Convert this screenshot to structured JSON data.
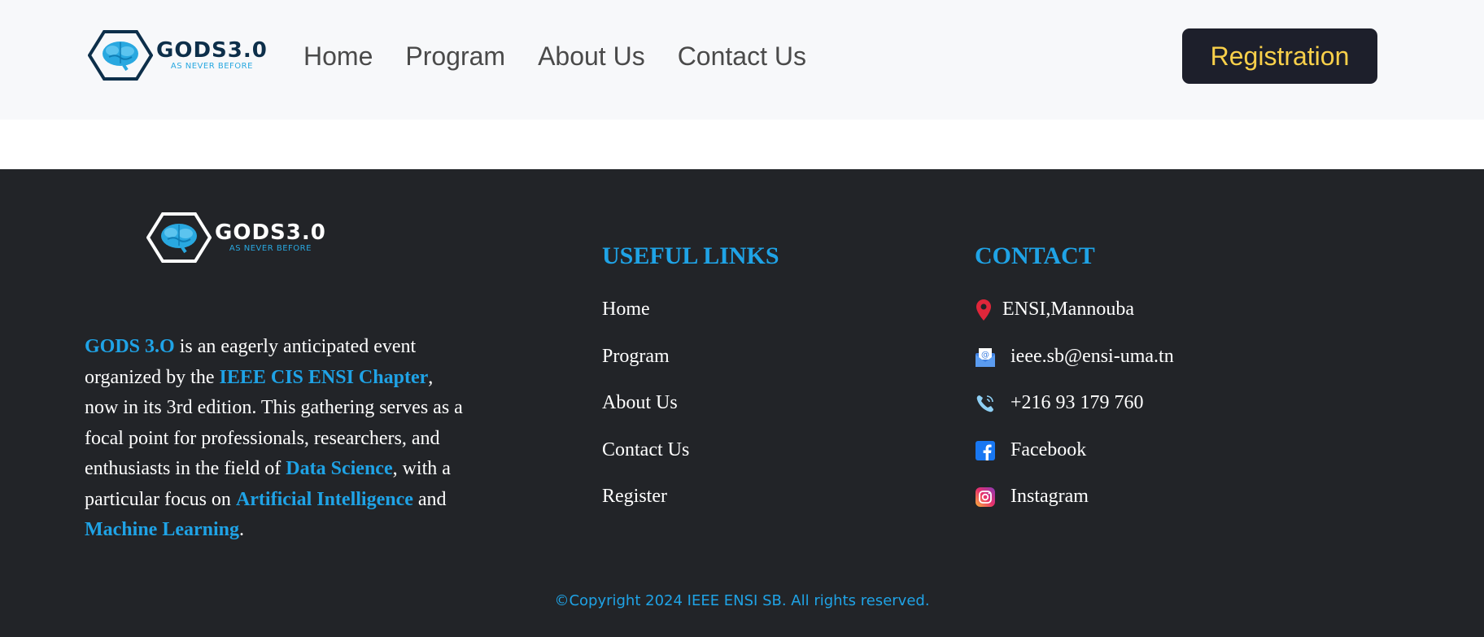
{
  "brand": {
    "name": "GODS3.0",
    "tagline": "AS NEVER BEFORE"
  },
  "nav": {
    "items": [
      "Home",
      "Program",
      "About Us",
      "Contact Us"
    ],
    "cta_label": "Registration"
  },
  "footer": {
    "about": {
      "event_name": "GODS 3.O",
      "text1": " is an eagerly anticipated event organized by the ",
      "chapter": "IEEE CIS ENSI Chapter",
      "text2": ", now in its 3rd edition. This gathering serves as a focal point for professionals, researchers, and enthusiasts in the field of ",
      "field1": "Data Science",
      "text3": ", with a particular focus on ",
      "field2": "Artificial Intelligence",
      "text4": " and ",
      "field3": "Machine Learning",
      "text5": "."
    },
    "useful_links": {
      "title": "USEFUL LINKS",
      "items": [
        "Home",
        "Program",
        "About Us",
        "Contact Us",
        "Register"
      ]
    },
    "contact": {
      "title": "CONTACT",
      "items": [
        {
          "icon": "location-pin-icon",
          "text": "ENSI,Mannouba"
        },
        {
          "icon": "email-icon",
          "text": "ieee.sb@ensi-uma.tn"
        },
        {
          "icon": "phone-icon",
          "text": "+216 93 179 760"
        },
        {
          "icon": "facebook-icon",
          "text": "Facebook"
        },
        {
          "icon": "instagram-icon",
          "text": "Instagram"
        }
      ]
    },
    "copyright": "©Copyright 2024 IEEE ENSI SB. All rights reserved."
  },
  "colors": {
    "accent": "#1fa3e6",
    "header_bg": "#f7f8fa",
    "footer_bg": "#222428",
    "button_bg": "#1d1f2b",
    "button_text": "#f9d04a",
    "logo_dark": "#0d2f4a"
  }
}
